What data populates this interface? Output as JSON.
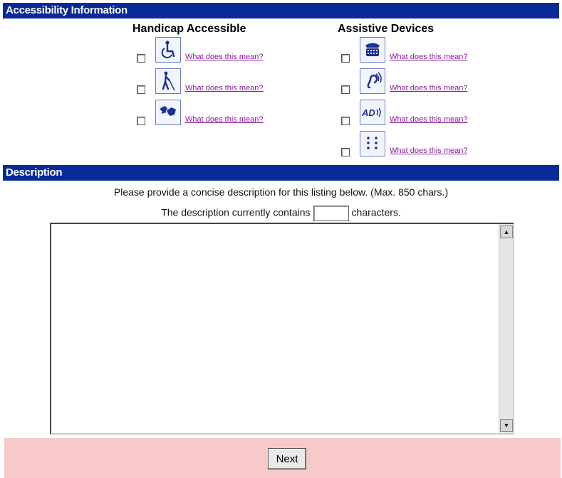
{
  "sections": {
    "accessibility_title": "Accessibility Information",
    "description_title": "Description"
  },
  "accessibility": {
    "left_heading": "Handicap Accessible",
    "right_heading": "Assistive Devices",
    "left_items": [
      {
        "icon": "wheelchair-icon",
        "link": "What does this mean?",
        "checked": false
      },
      {
        "icon": "blind-cane-icon",
        "link": "What does this mean?",
        "checked": false
      },
      {
        "icon": "sign-language-icon",
        "link": "What does this mean?",
        "checked": false
      }
    ],
    "right_items": [
      {
        "icon": "tty-icon",
        "link": "What does this mean?",
        "checked": false
      },
      {
        "icon": "hearing-assist-icon",
        "link": "What does this mean?",
        "checked": false
      },
      {
        "icon": "audio-description-icon",
        "link": "What does this mean?",
        "checked": false,
        "label": "AD"
      },
      {
        "icon": "braille-icon",
        "link": "What does this mean?",
        "checked": false
      }
    ]
  },
  "description": {
    "prompt": "Please provide a concise description for this listing below. (Max. 850 chars.)",
    "count_prefix": "The description currently contains",
    "count_suffix": "characters.",
    "count_value": "",
    "text": ""
  },
  "footer": {
    "next_label": "Next"
  },
  "colors": {
    "section_bar": "#0a2a9a",
    "footer_bg": "#f7c9c9",
    "link": "#8a1a9a"
  }
}
